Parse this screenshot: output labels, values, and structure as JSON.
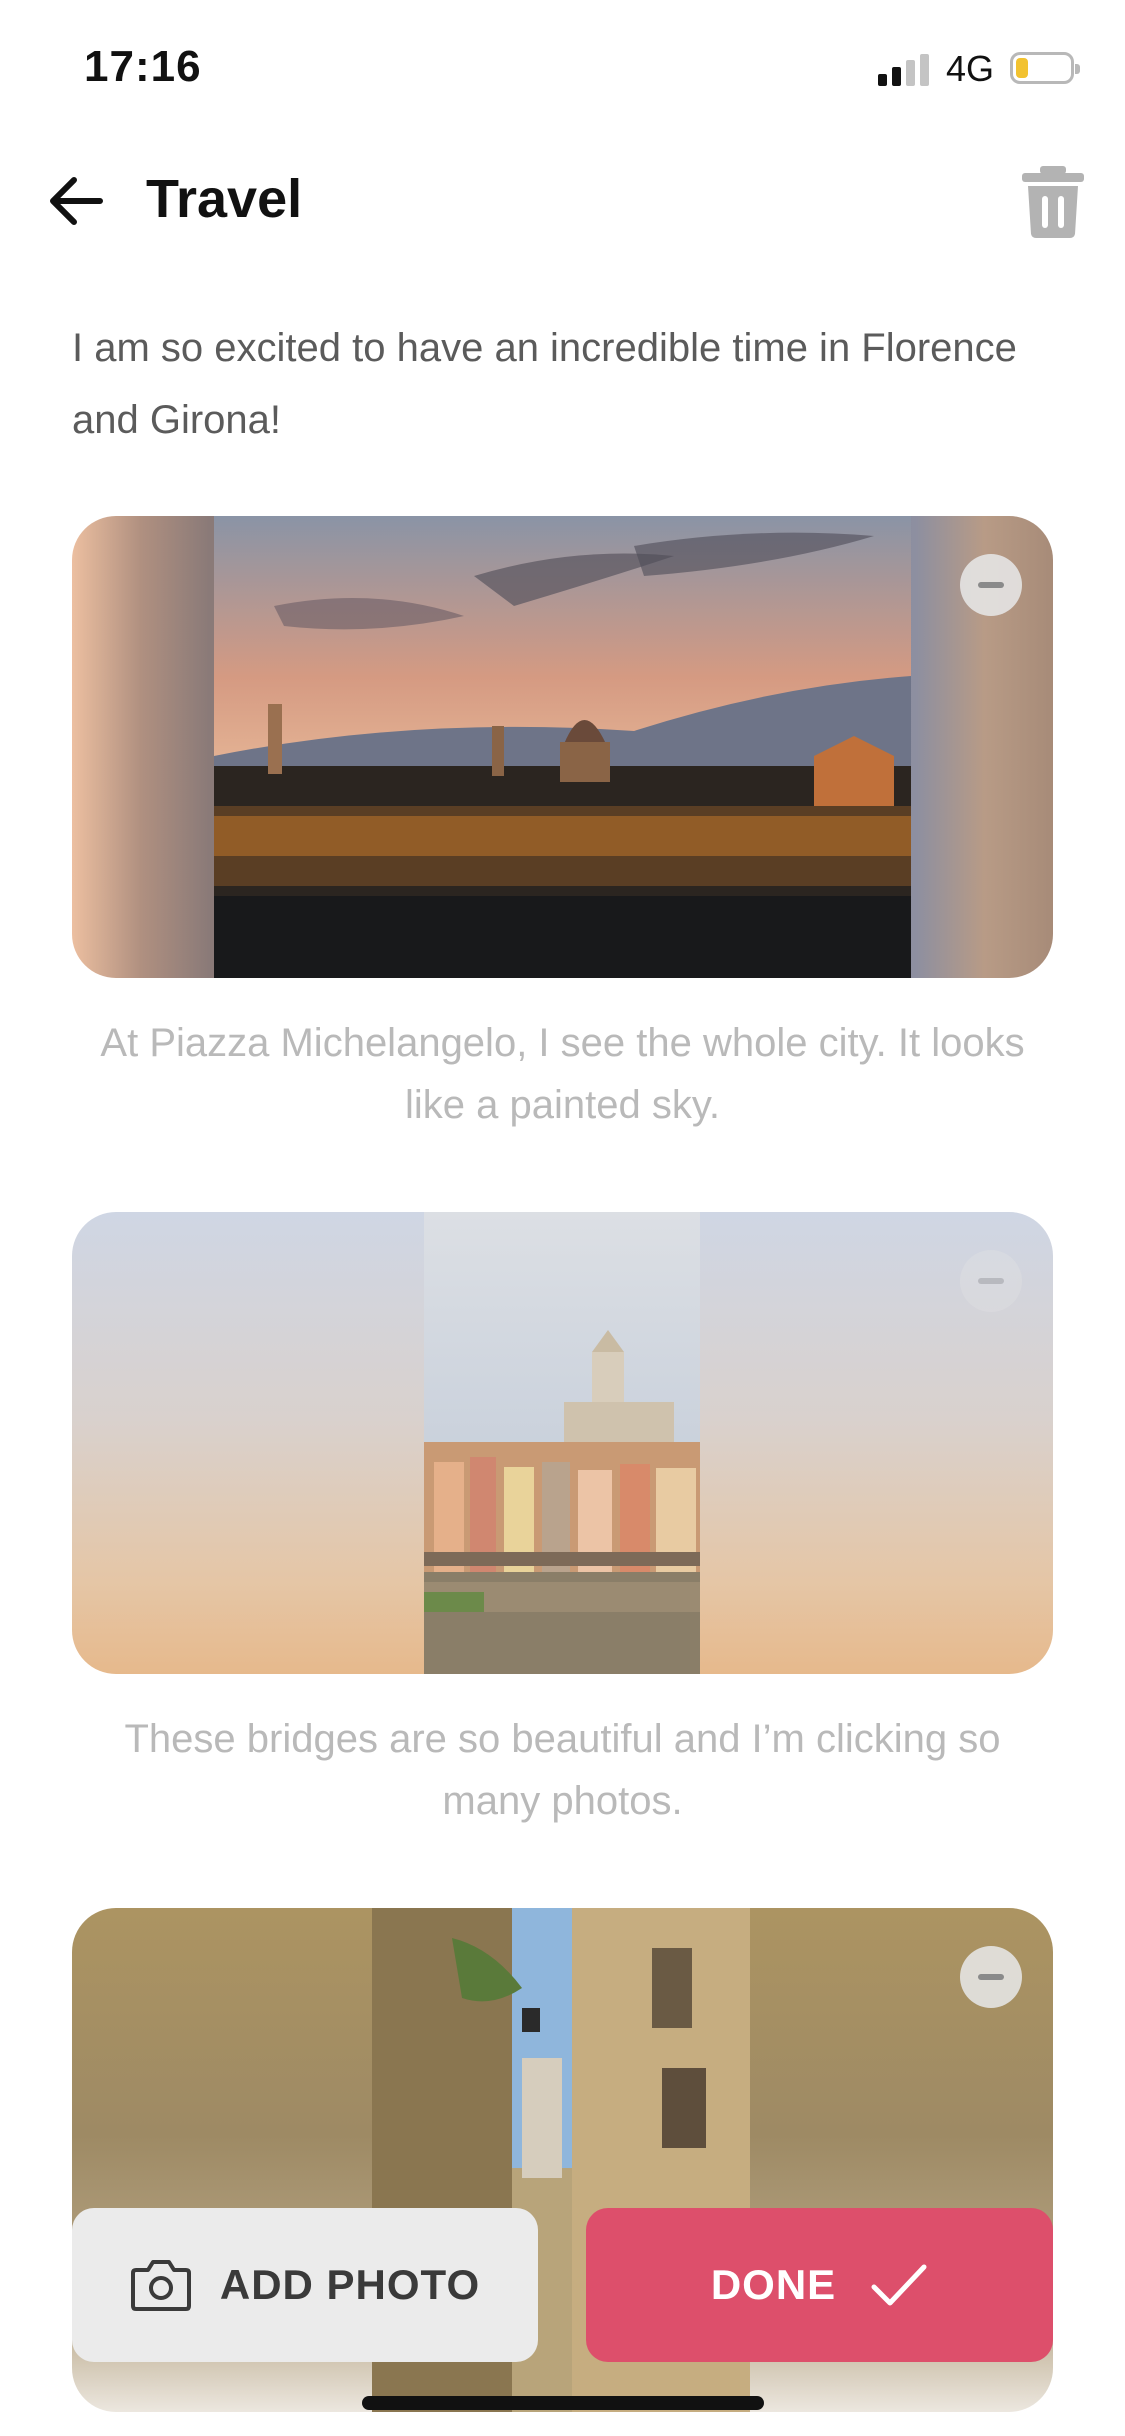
{
  "status_bar": {
    "time": "17:16",
    "network": "4G"
  },
  "header": {
    "title": "Travel"
  },
  "intro_text": "I am so excited to have an incredible time in Florence and Girona!",
  "entries": [
    {
      "caption": "At Piazza Michelangelo, I see the whole city. It looks like a painted sky."
    },
    {
      "caption": "These bridges are so beautiful and I’m clicking so many photos."
    },
    {
      "caption": ""
    }
  ],
  "actions": {
    "add_photo_label": "ADD PHOTO",
    "done_label": "DONE"
  },
  "colors": {
    "accent": "#dd4f6b",
    "secondary_button": "#ebebeb",
    "caption_text": "#b9b9b9"
  }
}
